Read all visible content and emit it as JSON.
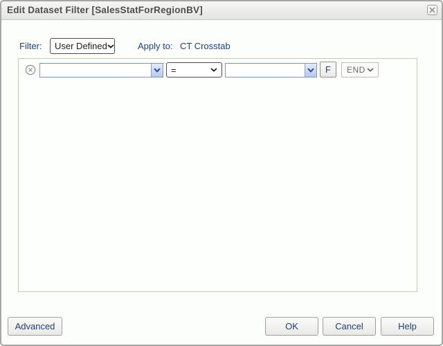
{
  "dialog": {
    "title": "Edit Dataset Filter [SalesStatForRegionBV]"
  },
  "filter_bar": {
    "filter_label": "Filter:",
    "filter_select_value": "User Defined",
    "apply_to_label": "Apply to:",
    "apply_to_value": "CT Crosstab"
  },
  "filter_row": {
    "field_select_value": "",
    "operator_select_value": "=",
    "value_select_value": "",
    "formula_button_label": "F",
    "logic_select_value": "END"
  },
  "footer": {
    "advanced_label": "Advanced",
    "ok_label": "OK",
    "cancel_label": "Cancel",
    "help_label": "Help"
  },
  "icons": {
    "close": "close-x",
    "remove_condition": "circle-x",
    "dropdown": "chevron-down"
  },
  "colors": {
    "accent_text": "#1e3f76",
    "title_text": "#4e4e4e",
    "combo_border": "#7796bb",
    "combo_arrow_bg": "#c3d1ef",
    "panel_border": "#c6c6c1",
    "dialog_border": "#a6a6a4"
  }
}
